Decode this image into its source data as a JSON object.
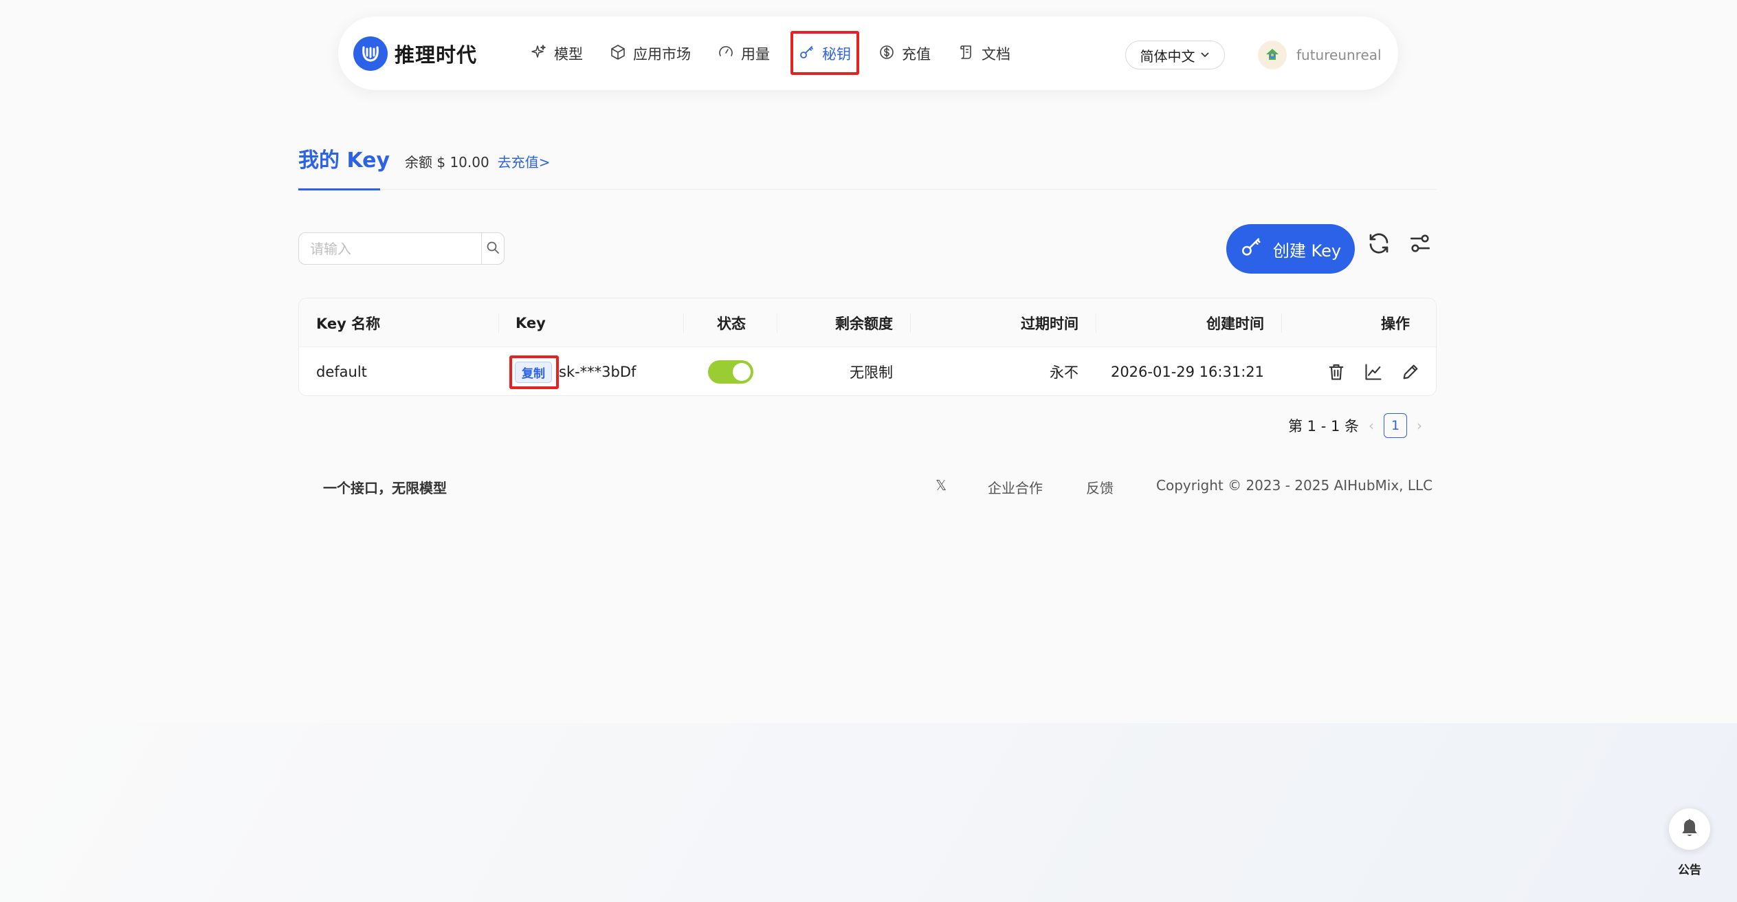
{
  "brand": {
    "name": "推理时代",
    "accent": "#2b62e8"
  },
  "nav": {
    "items": [
      {
        "label": "模型",
        "icon": "sparkle-icon"
      },
      {
        "label": "应用市场",
        "icon": "cube-icon"
      },
      {
        "label": "用量",
        "icon": "gauge-icon"
      },
      {
        "label": "秘钥",
        "icon": "key-icon",
        "active": true
      },
      {
        "label": "充值",
        "icon": "dollar-icon"
      },
      {
        "label": "文档",
        "icon": "scroll-icon"
      }
    ],
    "language": "简体中文",
    "username": "futureunreal"
  },
  "page": {
    "title": "我的 Key",
    "balance_label": "余额 $ 10.00",
    "recharge_link": "去充值>"
  },
  "search": {
    "placeholder": "请输入",
    "value": ""
  },
  "actions": {
    "create_label": "创建 Key"
  },
  "table": {
    "headers": [
      "Key 名称",
      "Key",
      "状态",
      "剩余额度",
      "过期时间",
      "创建时间",
      "操作"
    ],
    "rows": [
      {
        "name": "default",
        "copy_label": "复制",
        "key": "sk-***3bDf",
        "enabled": true,
        "quota": "无限制",
        "expires": "永不",
        "created": "2026-01-29 16:31:21"
      }
    ]
  },
  "pagination": {
    "summary": "第 1 - 1 条",
    "current": "1"
  },
  "footer": {
    "tagline": "一个接口，无限模型",
    "x_label": "𝕏",
    "link_business": "企业合作",
    "link_feedback": "反馈",
    "copyright": "Copyright © 2023 - 2025 AIHubMix, LLC"
  },
  "notice": {
    "label": "公告"
  },
  "colors": {
    "accent": "#2b62e8",
    "toggle_on": "#9acd32",
    "highlight": "#e52222"
  }
}
